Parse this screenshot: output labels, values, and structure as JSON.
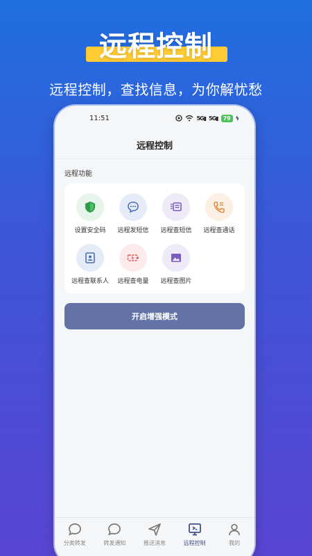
{
  "hero": {
    "title": "远程控制",
    "subtitle": "远程控制，查找信息，为你解忧愁"
  },
  "status_bar": {
    "time": "11:51",
    "network_1": "5G",
    "network_2": "5G",
    "battery": "79"
  },
  "navbar": {
    "title": "远程控制"
  },
  "section": {
    "title": "远程功能"
  },
  "functions": [
    {
      "label": "设置安全码",
      "icon": "shield-check-icon",
      "bg": "#e6f4ea",
      "color": "#2f9a4a"
    },
    {
      "label": "远程发短信",
      "icon": "chat-bubble-icon",
      "bg": "#e5ecf8",
      "color": "#4a6fb5"
    },
    {
      "label": "远程查短信",
      "icon": "message-list-icon",
      "bg": "#eeeaf7",
      "color": "#7a5cc0"
    },
    {
      "label": "远程查通话",
      "icon": "phone-call-icon",
      "bg": "#fcefe3",
      "color": "#e08b3a"
    },
    {
      "label": "远程查联系人",
      "icon": "contact-card-icon",
      "bg": "#e5ecf8",
      "color": "#4a6fb5"
    },
    {
      "label": "远程查电量",
      "icon": "battery-charge-icon",
      "bg": "#fdeaea",
      "color": "#e05555"
    },
    {
      "label": "远程查图片",
      "icon": "image-icon",
      "bg": "#eeeaf7",
      "color": "#7a5cc0"
    }
  ],
  "enhance_button": {
    "label": "开启增强模式"
  },
  "tabs": [
    {
      "label": "分类转发",
      "icon": "chat-bubble-outline-icon",
      "active": false
    },
    {
      "label": "转发通知",
      "icon": "chat-bubble-outline-icon",
      "active": false
    },
    {
      "label": "推送消息",
      "icon": "send-icon",
      "active": false
    },
    {
      "label": "远程控制",
      "icon": "remote-screen-icon",
      "active": true
    },
    {
      "label": "我的",
      "icon": "user-icon",
      "active": false
    }
  ],
  "colors": {
    "accent": "#3f4f86",
    "highlight": "#ffcc33",
    "button": "#6373a8"
  }
}
